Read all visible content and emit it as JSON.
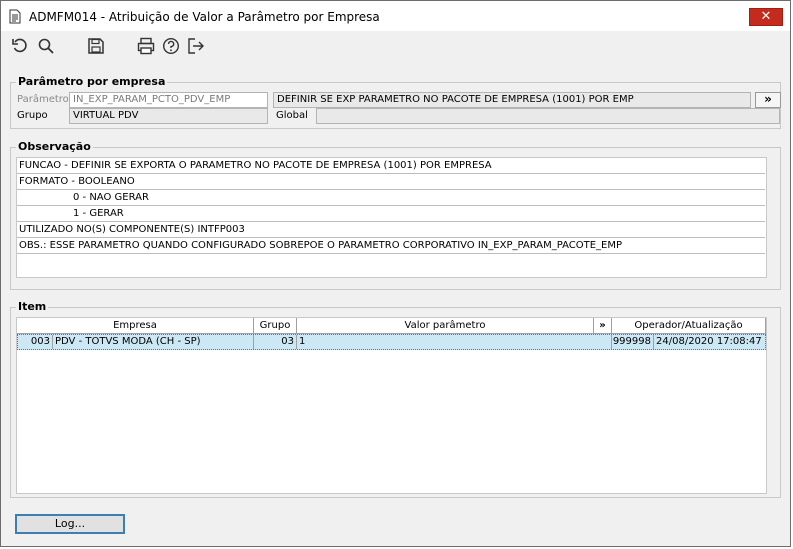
{
  "window": {
    "title": "ADMFM014 - Atribuição de Valor a Parâmetro por Empresa",
    "close_glyph": "✕"
  },
  "toolbar": {
    "icons": [
      "undo-icon",
      "search-icon",
      "save-icon",
      "print-icon",
      "help-icon",
      "exit-icon"
    ]
  },
  "param_group": {
    "title": "Parâmetro por empresa",
    "parametro_label": "Parâmetro",
    "parametro_value": "IN_EXP_PARAM_PCTO_PDV_EMP",
    "description": "DEFINIR SE EXP PARAMETRO NO PACOTE DE EMPRESA (1001) POR EMP",
    "more_glyph": "»",
    "grupo_label": "Grupo",
    "grupo_value": "VIRTUAL PDV",
    "global_label": "Global",
    "global_value": ""
  },
  "observacao": {
    "title": "Observação",
    "lines": [
      "FUNCAO - DEFINIR SE EXPORTA O PARAMETRO NO PACOTE DE EMPRESA (1001) POR EMPRESA",
      "FORMATO - BOOLEANO",
      "0 - NAO GERAR",
      "1 - GERAR",
      "UTILIZADO NO(S) COMPONENTE(S) INTFP003",
      "OBS.: ESSE PARAMETRO QUANDO CONFIGURADO SOBREPOE O PARAMETRO CORPORATIVO IN_EXP_PARAM_PACOTE_EMP"
    ]
  },
  "item": {
    "title": "Item",
    "columns": [
      "Empresa",
      "Grupo",
      "Valor parâmetro",
      "»",
      "Operador/Atualização"
    ],
    "rows": [
      {
        "empresa_code": "003",
        "empresa_name": "PDV - TOTVS MODA (CH - SP)",
        "grupo": "03",
        "valor": "1",
        "operador": "999998",
        "atualizacao": "24/08/2020 17:08:47"
      }
    ]
  },
  "footer": {
    "log_label": "Log..."
  }
}
